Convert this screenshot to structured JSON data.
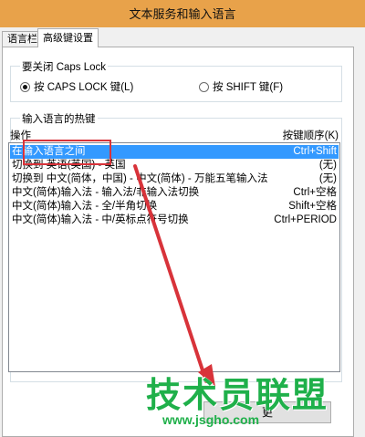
{
  "window": {
    "title": "文本服务和输入语言"
  },
  "tabs": [
    {
      "label": "语言栏",
      "active": false
    },
    {
      "label": "高级键设置",
      "active": true
    }
  ],
  "caps_lock_group": {
    "title": "要关闭 Caps Lock",
    "options": [
      {
        "label": "按 CAPS LOCK 键(L)",
        "checked": true
      },
      {
        "label": "按 SHIFT 键(F)",
        "checked": false
      }
    ]
  },
  "hotkeys_group": {
    "title": "输入语言的热键",
    "col_action": "操作",
    "col_keys": "按键顺序(K)",
    "rows": [
      {
        "action": "在输入语言之间",
        "keys": "Ctrl+Shift",
        "selected": true
      },
      {
        "action": "切换到 英语(英国) - 英国",
        "keys": "(无)",
        "selected": false
      },
      {
        "action": "切换到 中文(简体，中国) - 中文(简体) - 万能五笔输入法",
        "keys": "(无)",
        "selected": false
      },
      {
        "action": "中文(简体)输入法 - 输入法/非输入法切换",
        "keys": "Ctrl+空格",
        "selected": false
      },
      {
        "action": "中文(简体)输入法 - 全/半角切换",
        "keys": "Shift+空格",
        "selected": false
      },
      {
        "action": "中文(简体)输入法 - 中/英标点符号切换",
        "keys": "Ctrl+PERIOD",
        "selected": false
      }
    ]
  },
  "buttons": {
    "change_label": "更"
  },
  "watermark": {
    "text": "技术员联盟",
    "url": "www.jsgho.com"
  },
  "colors": {
    "titlebar": "#e8a24a",
    "selection": "#3399ff",
    "annotation": "#d8333a",
    "watermark": "#1fb04a"
  }
}
